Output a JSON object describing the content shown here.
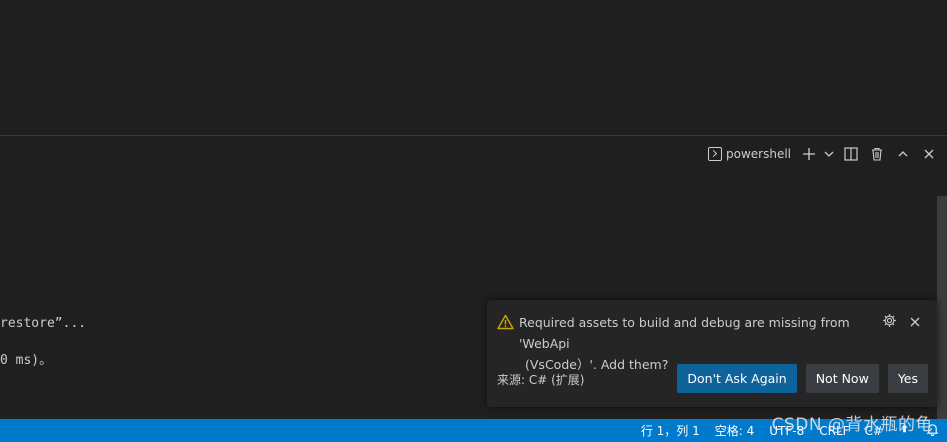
{
  "panel": {
    "terminal_name": "powershell",
    "icons": {
      "terminal": "terminal-icon",
      "add": "plus-icon",
      "dropdown": "chevron-down-icon",
      "split": "split-terminal-icon",
      "kill": "trash-icon",
      "maximize": "chevron-up-icon",
      "close": "close-icon"
    }
  },
  "terminal": {
    "lines": [
      "restore”...",
      "0 ms)。"
    ]
  },
  "notification": {
    "message_line1": "Required assets to build and debug are missing from 'WebApi",
    "message_line2": "(VsCode）'. Add them?",
    "source": "来源: C# (扩展)",
    "buttons": {
      "dont_ask": "Don't Ask Again",
      "not_now": "Not Now",
      "yes": "Yes"
    },
    "icons": {
      "warning": "warning-icon",
      "settings": "gear-icon",
      "close": "close-icon"
    }
  },
  "statusbar": {
    "position": "行 1，列 1",
    "indent": "空格: 4",
    "encoding": "UTF-8",
    "eol": "CRLF",
    "language": "C#"
  },
  "watermark": "CSDN @背水瓶的龟",
  "colors": {
    "background": "#1f1f1f",
    "statusbar": "#007acc",
    "primary_button": "#0e639c",
    "secondary_button": "#3a3d41",
    "warning": "#cca700"
  }
}
